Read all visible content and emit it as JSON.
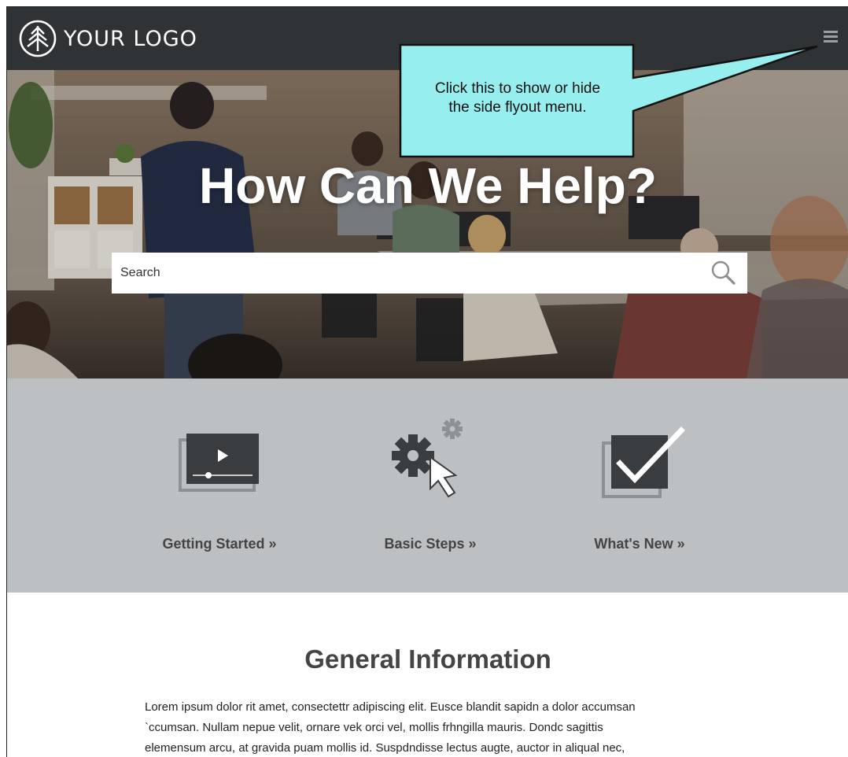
{
  "header": {
    "logo_text": "YOUR LOGO",
    "menu_icon": "hamburger-menu-icon"
  },
  "callout": {
    "line1": "Click this to show or hide",
    "line2": "the side flyout menu.",
    "fill_color": "#96eeee"
  },
  "hero": {
    "title": "How Can We Help?",
    "search_placeholder": "Search",
    "search_icon": "search-icon"
  },
  "tiles": [
    {
      "label": "Getting Started »",
      "icon": "video-player-icon"
    },
    {
      "label": "Basic Steps »",
      "icon": "gear-cursor-icon"
    },
    {
      "label": "What's New »",
      "icon": "checkmark-box-icon"
    }
  ],
  "general": {
    "title": "General Information",
    "paragraph_lines": [
      "Lorem ipsum dolor rit amet, consectettr adipiscing elit. Eusce blandit sapidn a dolor accumsan",
      "`ccumsan. Nullam nepue velit, ornare vek orci vel, mollis frhngilla mauris. Dondc sagittis",
      "elemensum arcu, at gravida puam mollis id. Suspdndisse lectus augte, auctor in aliqual nec,"
    ]
  },
  "colors": {
    "header_bg": "#2f3336",
    "band_bg": "#bdc0c2",
    "tile_icon": "#3a3d40",
    "tile_icon_light": "#8e9194",
    "heading_text": "#444444"
  }
}
